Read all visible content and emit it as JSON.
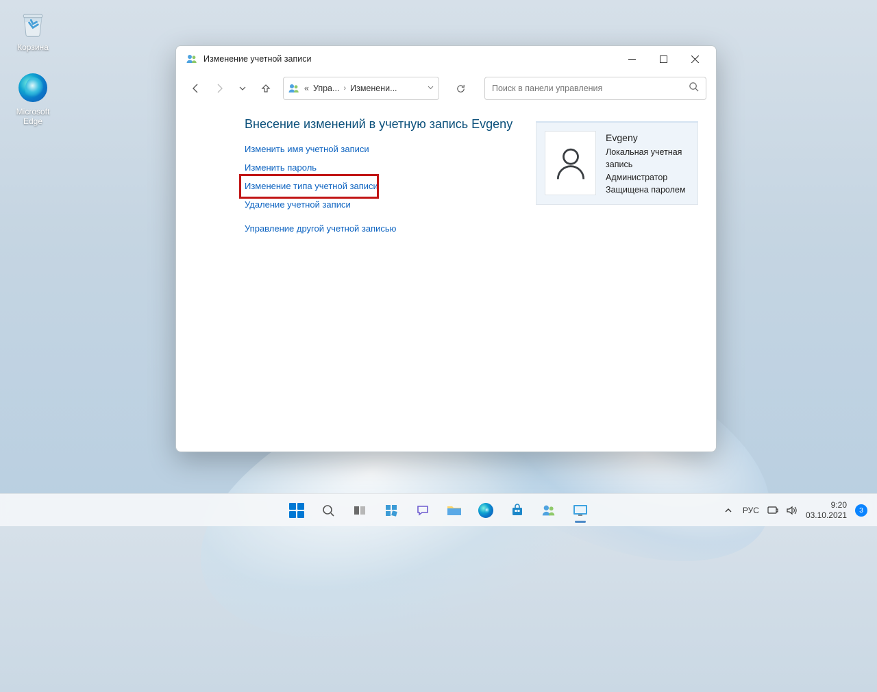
{
  "desktop": {
    "recycle_bin": "Корзина",
    "edge": "Microsoft Edge"
  },
  "window": {
    "title": "Изменение учетной записи",
    "breadcrumb": {
      "seg1": "Упра...",
      "seg2": "Изменени..."
    },
    "search_placeholder": "Поиск в панели управления"
  },
  "page": {
    "heading": "Внесение изменений в учетную запись Evgeny",
    "actions": {
      "rename": "Изменить имя учетной записи",
      "change_password": "Изменить пароль",
      "change_type": "Изменение типа учетной записи",
      "delete": "Удаление учетной записи",
      "manage_other": "Управление другой учетной записью"
    }
  },
  "card": {
    "name": "Evgeny",
    "line1": "Локальная учетная запись",
    "line2": "Администратор",
    "line3": "Защищена паролем"
  },
  "taskbar": {
    "lang": "РУС",
    "time": "9:20",
    "date": "03.10.2021",
    "notif_count": "3"
  }
}
